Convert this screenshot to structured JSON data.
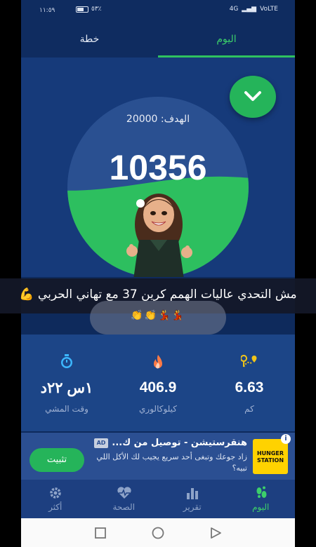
{
  "status_bar": {
    "time": "١١:٥٩",
    "battery": "٥٣٪",
    "network": "4G",
    "carrier": "VoLTE"
  },
  "tabs": [
    {
      "label": "اليوم",
      "active": true
    },
    {
      "label": "خطة",
      "active": false
    }
  ],
  "main": {
    "goal_label": "الهدف: 20000",
    "steps": "10356",
    "progress_fraction": 0.52
  },
  "caption": {
    "text": "مش التحدي عاليات الهمم كرين 37 مع تهاني الحربي 💪",
    "emojis": "👏👏💃💃"
  },
  "stats": [
    {
      "value": "6.63",
      "label": "كم",
      "icon": "location-route-icon",
      "color": "#f0c419"
    },
    {
      "value": "406.9",
      "label": "كيلوكالوري",
      "icon": "flame-icon",
      "color": "#ff7a45"
    },
    {
      "value": "١س ٢٢د",
      "label": "وقت المشي",
      "icon": "stopwatch-icon",
      "color": "#3cb7ff"
    }
  ],
  "ad": {
    "tag": "AD",
    "title": "هنقرستيشن - توصيل من ك...",
    "body": "زاد جوعك وتبغى أحد سريع يجيب لك الأكل اللي تبيه؟",
    "install_label": "تثبيت",
    "logo_text": "HUNGER STATION",
    "info": "i"
  },
  "bottom_nav": [
    {
      "label": "اليوم",
      "icon": "footprints-icon",
      "active": true
    },
    {
      "label": "تقرير",
      "icon": "bar-chart-icon",
      "active": false
    },
    {
      "label": "الصحة",
      "icon": "heart-pulse-icon",
      "active": false
    },
    {
      "label": "أكثر",
      "icon": "gear-icon",
      "active": false
    }
  ],
  "colors": {
    "accent": "#25b45a",
    "background": "#163a7a",
    "gauge_fill": "#2dbf5f"
  }
}
